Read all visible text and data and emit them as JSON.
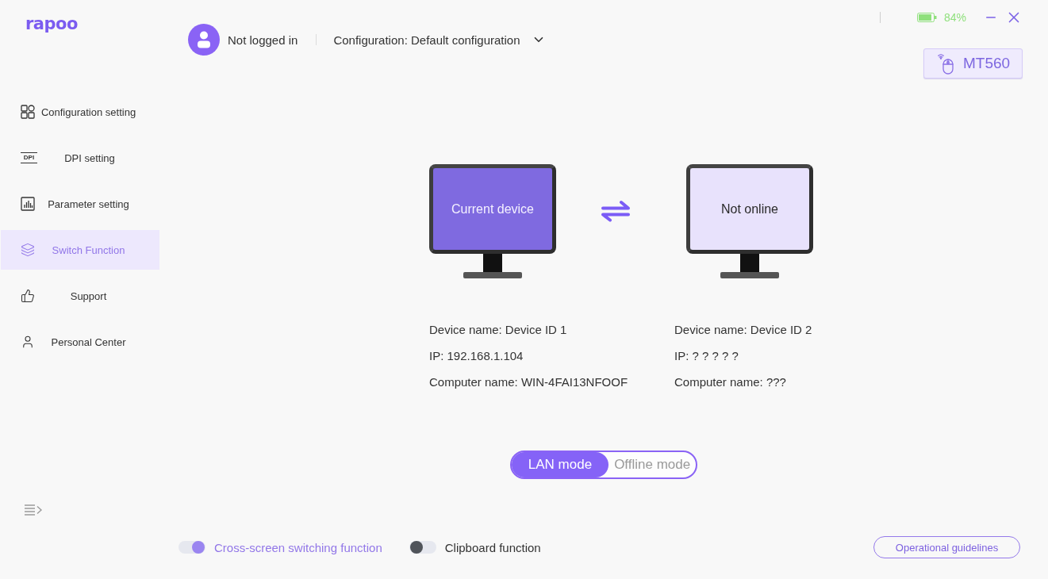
{
  "logo": "rapoo",
  "header": {
    "user_status": "Not logged in",
    "configuration": "Configuration: Default configuration"
  },
  "status": {
    "battery": "84%"
  },
  "device": {
    "model": "MT560"
  },
  "sidebar": {
    "items": [
      {
        "label": "Configuration setting",
        "selected": false
      },
      {
        "label": "DPI setting",
        "icon_text": "DPI",
        "selected": false
      },
      {
        "label": "Parameter setting",
        "selected": false
      },
      {
        "label": "Switch Function",
        "selected": true
      },
      {
        "label": "Support",
        "selected": false
      },
      {
        "label": "Personal Center",
        "selected": false
      }
    ]
  },
  "devices": [
    {
      "screen_label": "Current device",
      "current": true,
      "details": [
        "Device name: Device ID 1",
        "IP: 192.168.1.104",
        "Computer name: WIN-4FAI13NFOOF"
      ]
    },
    {
      "screen_label": "Not online",
      "current": false,
      "details": [
        "Device name: Device ID 2",
        "IP: ? ? ? ? ?",
        "Computer name: ???"
      ]
    }
  ],
  "mode_switch": {
    "options": [
      {
        "label": "LAN mode",
        "selected": true
      },
      {
        "label": "Offline mode",
        "selected": false
      }
    ]
  },
  "toggles": [
    {
      "label": "Cross-screen switching function",
      "on": true
    },
    {
      "label": "Clipboard function",
      "on": false
    }
  ],
  "guide_button": "Operational guidelines"
}
